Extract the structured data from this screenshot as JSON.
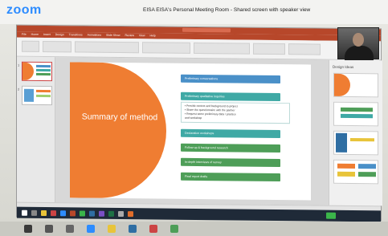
{
  "zoom": {
    "logo": "zoom",
    "title": "EISA EISA's Personal Meeting Room - Shared screen with speaker view"
  },
  "ppt": {
    "ribbon_tabs": [
      "File",
      "Home",
      "Insert",
      "Design",
      "Transitions",
      "Animations",
      "Slide Show",
      "Review",
      "View",
      "Help"
    ],
    "thumbnail_numbers": [
      "1",
      "2"
    ]
  },
  "slide": {
    "title": "Summary of method",
    "steps": [
      {
        "label": "Preliminary conversations",
        "color": "blue"
      },
      {
        "label": "Preliminary qualitative inquiries",
        "color": "teal"
      },
      {
        "label": "Declaration workshops",
        "color": "teal"
      },
      {
        "label": "Follow-up & background research",
        "color": "green"
      },
      {
        "label": "In-depth interviews of survey",
        "color": "green"
      },
      {
        "label": "Final report drafts",
        "color": "green"
      }
    ],
    "bullets": [
      "• Provide context and background to project",
      "• Share the questionnaire with the partner",
      "• Request some preliminary data / practice",
      "  and workshop"
    ]
  },
  "design_pane": {
    "title": "Design Ideas"
  },
  "colors": {
    "accent_orange": "#ef7d32",
    "ppt_red": "#b7472a",
    "zoom_blue": "#2d8cff",
    "taskbar": "#1f2a38"
  }
}
